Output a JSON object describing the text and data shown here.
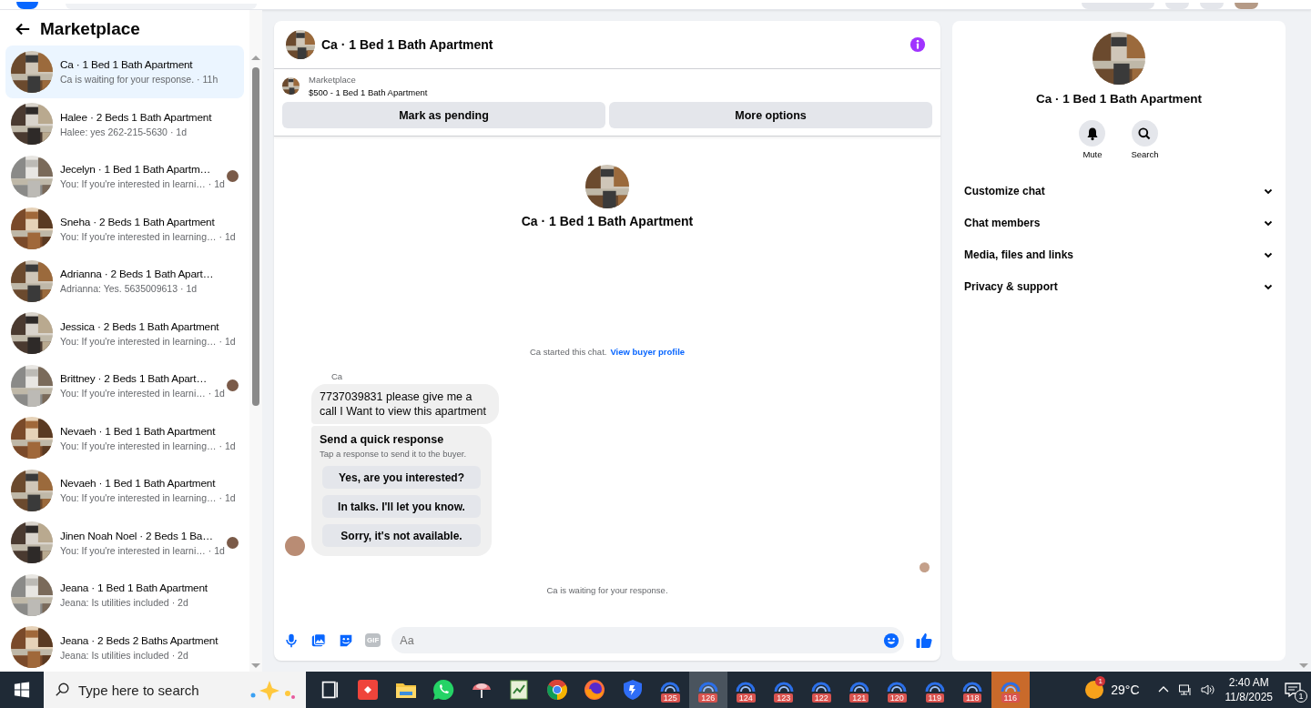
{
  "sidebar": {
    "title": "Marketplace"
  },
  "conversations": [
    {
      "title": "Ca · 1 Bed 1 Bath Apartment",
      "snippet": "Ca is waiting for your response.",
      "time": "· 11h",
      "selected": true,
      "read_receipt": false
    },
    {
      "title": "Halee · 2 Beds 1 Bath Apartment",
      "snippet": "Halee: yes 262-215-5630",
      "time": "· 1d",
      "selected": false,
      "read_receipt": false
    },
    {
      "title": "Jecelyn · 1 Bed 1 Bath Apartm…",
      "snippet": "You: If you're interested in learni…",
      "time": "· 1d",
      "selected": false,
      "read_receipt": true
    },
    {
      "title": "Sneha · 2 Beds 1 Bath Apartment",
      "snippet": "You: If you're interested in learning…",
      "time": "· 1d",
      "selected": false,
      "read_receipt": false
    },
    {
      "title": "Adrianna · 2 Beds 1 Bath Apart…",
      "snippet": "Adrianna: Yes. 5635009613",
      "time": "· 1d",
      "selected": false,
      "read_receipt": false
    },
    {
      "title": "Jessica · 2 Beds 1 Bath Apartment",
      "snippet": "You: If you're interested in learning…",
      "time": "· 1d",
      "selected": false,
      "read_receipt": false
    },
    {
      "title": "Brittney · 2 Beds 1 Bath Apart…",
      "snippet": "You: If you're interested in learni…",
      "time": "· 1d",
      "selected": false,
      "read_receipt": true
    },
    {
      "title": "Nevaeh · 1 Bed 1 Bath Apartment",
      "snippet": "You: If you're interested in learning…",
      "time": "· 1d",
      "selected": false,
      "read_receipt": false
    },
    {
      "title": "Nevaeh · 1 Bed 1 Bath Apartment",
      "snippet": "You: If you're interested in learning…",
      "time": "· 1d",
      "selected": false,
      "read_receipt": false
    },
    {
      "title": "Jinen Noah Noel · 2 Beds 1 Ba…",
      "snippet": "You: If you're interested in learni…",
      "time": "· 1d",
      "selected": false,
      "read_receipt": true
    },
    {
      "title": "Jeana · 1 Bed 1 Bath Apartment",
      "snippet": "Jeana: Is utilities included",
      "time": "· 2d",
      "selected": false,
      "read_receipt": false
    },
    {
      "title": "Jeana · 2 Beds 2 Baths Apartment",
      "snippet": "Jeana: Is utilities included",
      "time": "· 2d",
      "selected": false,
      "read_receipt": false
    }
  ],
  "chat": {
    "title": "Ca · 1 Bed 1 Bath Apartment",
    "listing": {
      "label": "Marketplace",
      "name": "$500 - 1 Bed 1 Bath Apartment"
    },
    "actions": [
      "Mark as pending",
      "More options"
    ],
    "intro_title": "Ca · 1 Bed 1 Bath Apartment",
    "started_text": "Ca started this chat.",
    "profile_link": "View buyer profile",
    "sender": "Ca",
    "message": "7737039831 please give me a call I Want to view this apartment",
    "quick_response": {
      "title": "Send a quick response",
      "hint": "Tap a response to send it to the buyer.",
      "options": [
        "Yes, are you interested?",
        "In talks. I'll let you know.",
        "Sorry, it's not available."
      ]
    },
    "status": "Ca is waiting for your response.",
    "composer": {
      "gif_label": "GIF",
      "placeholder": "Aa"
    }
  },
  "details": {
    "title": "Ca · 1 Bed 1 Bath Apartment",
    "actions": [
      {
        "kind": "mute",
        "label": "Mute"
      },
      {
        "kind": "search",
        "label": "Search"
      }
    ],
    "sections": [
      {
        "label": "Customize chat",
        "expanded": false
      },
      {
        "label": "Chat members",
        "expanded": false
      },
      {
        "label": "Media, files and links",
        "expanded": false
      },
      {
        "label": "Privacy & support",
        "expanded": false
      }
    ]
  },
  "taskbar": {
    "search_placeholder": "Type here to search",
    "apps": [
      {
        "kind": "taskview",
        "selected": false
      },
      {
        "kind": "diamond",
        "selected": false
      },
      {
        "kind": "folder",
        "selected": false
      },
      {
        "kind": "phone",
        "selected": false
      },
      {
        "kind": "umbrella",
        "selected": false
      },
      {
        "kind": "notepad",
        "selected": false
      },
      {
        "kind": "ring",
        "selected": false
      },
      {
        "kind": "fox",
        "selected": false
      },
      {
        "kind": "shield",
        "selected": false
      },
      {
        "kind": "profile",
        "badge": "125",
        "selected": false
      },
      {
        "kind": "profile",
        "badge": "126",
        "selected": true
      },
      {
        "kind": "profile",
        "badge": "124",
        "selected": false
      },
      {
        "kind": "profile",
        "badge": "123",
        "selected": false
      },
      {
        "kind": "profile",
        "badge": "122",
        "selected": false
      },
      {
        "kind": "profile",
        "badge": "121",
        "selected": false
      },
      {
        "kind": "profile",
        "badge": "120",
        "selected": false
      },
      {
        "kind": "profile",
        "badge": "119",
        "selected": false
      },
      {
        "kind": "profile",
        "badge": "118",
        "selected": false
      },
      {
        "kind": "profile",
        "badge": "116",
        "selected": false,
        "highlighted": true
      }
    ],
    "weather": {
      "alert": "1",
      "temperature": "29°C"
    },
    "time": "2:40 AM",
    "date": "11/8/2025",
    "notifications": "1"
  }
}
